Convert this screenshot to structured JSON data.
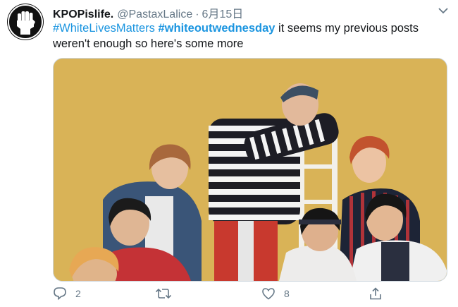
{
  "tweet": {
    "display_name": "KPOPislife.",
    "handle": "@PastaxLalice",
    "separator": "·",
    "date": "6月15日",
    "text_parts": {
      "hashtag1": "#WhiteLivesMatters",
      "hashtag2": "#whiteoutwednesday",
      "body": " it seems my previous posts weren't enough so here's some more"
    },
    "counts": {
      "replies": "2",
      "retweets": "",
      "likes": "8"
    }
  },
  "icons": {
    "avatar": "raised-fist-icon",
    "caret": "chevron-down-icon",
    "reply": "reply-icon",
    "retweet": "retweet-icon",
    "like": "heart-icon",
    "share": "share-icon"
  },
  "colors": {
    "hashtag": "#1b95e0",
    "muted": "#657786",
    "photo_background": "#d9b357"
  }
}
